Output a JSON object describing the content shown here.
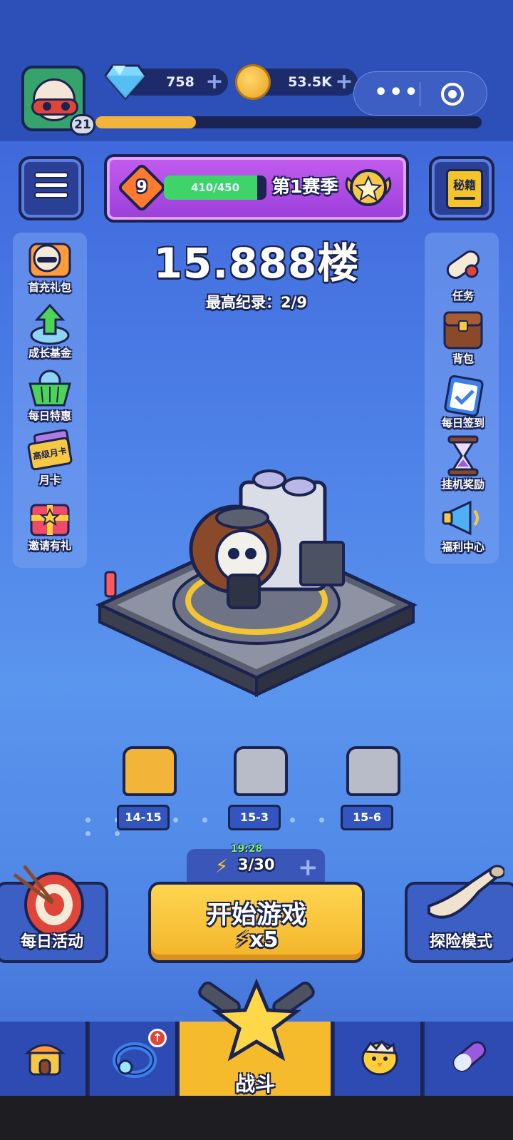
{
  "header": {
    "player_level": "21",
    "xp_progress": 0.26,
    "gems": "758",
    "coins": "53.5K",
    "miniapp_menu_icon": "ellipsis-icon",
    "miniapp_close_icon": "target-icon"
  },
  "season": {
    "rank": "9",
    "progress_text": "410/450",
    "progress_ratio": 0.91,
    "title": "第1赛季"
  },
  "top_buttons": {
    "menu_icon": "list-menu-icon",
    "secret_book_label": "秘籍"
  },
  "stage": {
    "floor": "15.888楼",
    "record": "最高纪录：2/9"
  },
  "left_menu": [
    {
      "label": "首充礼包",
      "icon": "gift-pack-icon"
    },
    {
      "label": "成长基金",
      "icon": "growth-fund-icon"
    },
    {
      "label": "每日特惠",
      "icon": "basket-icon"
    },
    {
      "label": "月卡",
      "icon": "month-card-icon",
      "card_text": "高级月卡"
    },
    {
      "label": "邀请有礼",
      "icon": "gift-box-icon"
    }
  ],
  "right_menu": [
    {
      "label": "任务",
      "icon": "scroll-icon"
    },
    {
      "label": "背包",
      "icon": "backpack-icon"
    },
    {
      "label": "每日签到",
      "icon": "clipboard-icon"
    },
    {
      "label": "挂机奖励",
      "icon": "hourglass-icon"
    },
    {
      "label": "福利中心",
      "icon": "megaphone-icon"
    }
  ],
  "chests": [
    {
      "label": "14-15",
      "type": "gold"
    },
    {
      "label": "15-3",
      "type": "silver"
    },
    {
      "label": "15-6",
      "type": "silver"
    }
  ],
  "energy": {
    "timer": "19:28",
    "count": "3/30"
  },
  "actions": {
    "daily_activity": "每日活动",
    "start_game": "开始游戏",
    "start_cost": "x5",
    "explore_mode": "探险模式"
  },
  "tabs": [
    {
      "icon": "shop-icon",
      "label": ""
    },
    {
      "icon": "ring-icon",
      "label": "",
      "badge": "upgrade"
    },
    {
      "icon": "star-cannon-icon",
      "label": "战斗",
      "active": true
    },
    {
      "icon": "chick-egg-icon",
      "label": ""
    },
    {
      "icon": "capsule-icon",
      "label": ""
    }
  ],
  "colors": {
    "accent": "#f5bb2d",
    "background": "#4b7de6",
    "outline": "#1b2350",
    "season": "#b04fe6"
  }
}
